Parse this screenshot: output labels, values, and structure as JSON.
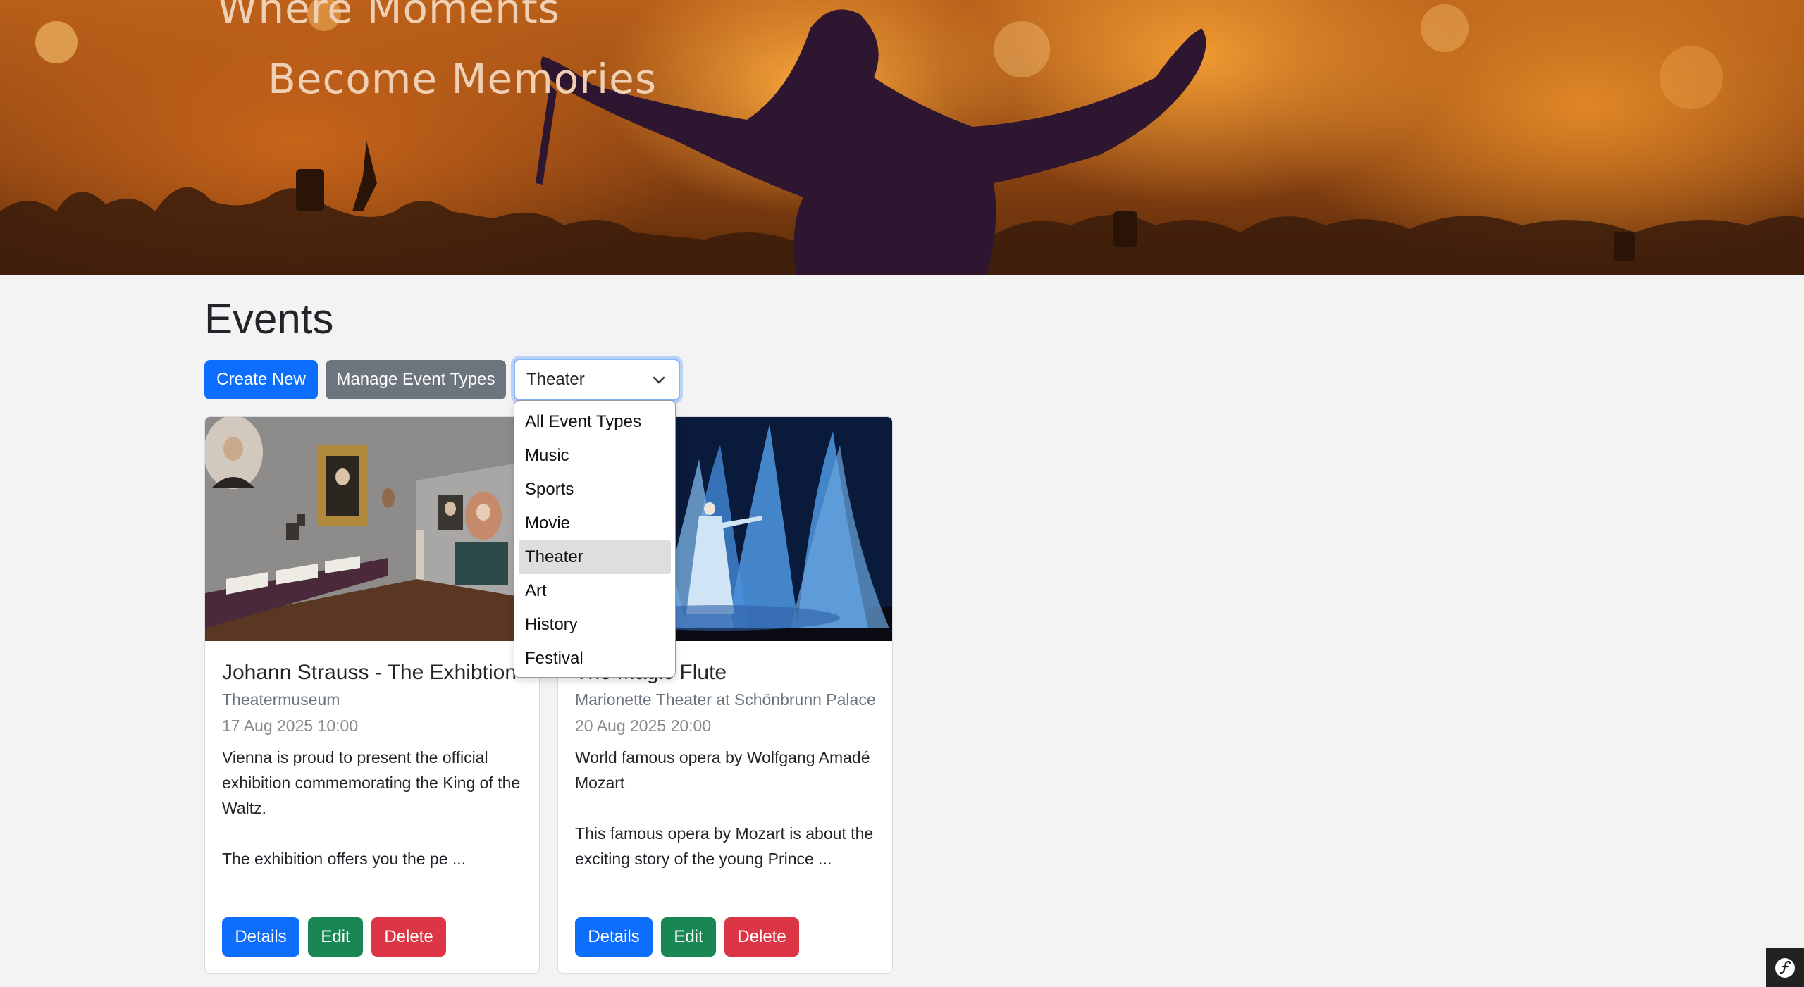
{
  "hero": {
    "line1": "Where Moments",
    "line2": "Become Memories"
  },
  "page": {
    "title": "Events"
  },
  "toolbar": {
    "create_label": "Create New",
    "manage_label": "Manage Event Types"
  },
  "filter": {
    "selected": "Theater",
    "options": [
      "All Event Types",
      "Music",
      "Sports",
      "Movie",
      "Theater",
      "Art",
      "History",
      "Festival"
    ]
  },
  "events": [
    {
      "title": "Johann Strauss - The Exhibtion",
      "venue": "Theatermuseum",
      "date": "17 Aug 2025 10:00",
      "description": "Vienna is proud to present the official exhibition commemorating the King of the Waltz.\n\nThe exhibition offers you the pe ...",
      "details_label": "Details",
      "edit_label": "Edit",
      "delete_label": "Delete"
    },
    {
      "title": "The Magic Flute",
      "venue": "Marionette Theater at Schönbrunn Palace",
      "date": "20 Aug 2025 20:00",
      "description": "World famous opera by Wolfgang Amadé Mozart\n\nThis famous opera by Mozart is about the exciting story of the young Prince ...",
      "details_label": "Details",
      "edit_label": "Edit",
      "delete_label": "Delete"
    }
  ],
  "colors": {
    "primary": "#0d6efd",
    "secondary": "#6c757d",
    "success": "#198754",
    "danger": "#dc3545",
    "hero_orange": "#e08726"
  },
  "icons": {
    "select": "chevron-down-icon",
    "debug_toolbar": "symfony-logo-icon"
  }
}
